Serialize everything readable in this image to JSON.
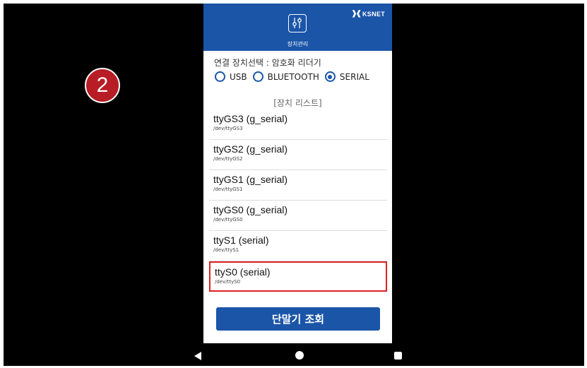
{
  "step_badge": "2",
  "header": {
    "brand": "KSNET",
    "brand_mark": "❱❰",
    "icon": "sliders-icon",
    "title": "장치관리"
  },
  "connection": {
    "label": "연결 장치선택 : 암호화 리더기",
    "options": [
      {
        "label": "USB",
        "checked": false
      },
      {
        "label": "BLUETOOTH",
        "checked": false
      },
      {
        "label": "SERIAL",
        "checked": true
      }
    ]
  },
  "device_list": {
    "title": "[장치 리스트]",
    "items": [
      {
        "name": "ttyGS3 (g_serial)",
        "path": "/dev/ttyGS3"
      },
      {
        "name": "ttyGS2 (g_serial)",
        "path": "/dev/ttyGS2"
      },
      {
        "name": "ttyGS1 (g_serial)",
        "path": "/dev/ttyGS1"
      },
      {
        "name": "ttyGS0 (g_serial)",
        "path": "/dev/ttyGS0"
      },
      {
        "name": "ttyS1 (serial)",
        "path": "/dev/ttyS1"
      },
      {
        "name": "ttyS0 (serial)",
        "path": "/dev/ttyS0"
      }
    ],
    "selected_index": 5
  },
  "query_button": "단말기 조회",
  "navbar": {
    "icons": [
      "back-icon",
      "home-icon",
      "recent-apps-icon"
    ]
  },
  "colors": {
    "primary": "#1a55a8",
    "highlight": "#e02020",
    "badge": "#b81c24"
  }
}
